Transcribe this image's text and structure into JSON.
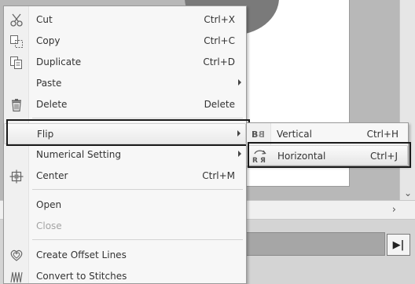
{
  "menu": {
    "items": [
      {
        "id": "cut",
        "label": "Cut",
        "shortcut": "Ctrl+X",
        "icon": "scissors-icon"
      },
      {
        "id": "copy",
        "label": "Copy",
        "shortcut": "Ctrl+C",
        "icon": "copy-icon"
      },
      {
        "id": "duplicate",
        "label": "Duplicate",
        "shortcut": "Ctrl+D",
        "icon": "duplicate-icon"
      },
      {
        "id": "paste",
        "label": "Paste",
        "shortcut": "",
        "submenu": true
      },
      {
        "id": "delete",
        "label": "Delete",
        "shortcut": "Delete",
        "icon": "trash-icon"
      },
      {
        "id": "flip",
        "label": "Flip",
        "shortcut": "",
        "submenu": true,
        "highlighted": true
      },
      {
        "id": "numerical-setting",
        "label": "Numerical Setting",
        "shortcut": "",
        "submenu": true
      },
      {
        "id": "center",
        "label": "Center",
        "shortcut": "Ctrl+M",
        "icon": "center-icon"
      },
      {
        "id": "open",
        "label": "Open",
        "shortcut": ""
      },
      {
        "id": "close",
        "label": "Close",
        "shortcut": "",
        "disabled": true
      },
      {
        "id": "create-offset-lines",
        "label": "Create Offset Lines",
        "shortcut": "",
        "icon": "offset-lines-icon"
      },
      {
        "id": "convert-to-stitches",
        "label": "Convert to Stitches",
        "shortcut": "",
        "icon": "stitches-icon"
      }
    ]
  },
  "submenu": {
    "items": [
      {
        "id": "vertical",
        "label": "Vertical",
        "shortcut": "Ctrl+H",
        "icon": "flip-vertical-icon"
      },
      {
        "id": "horizontal",
        "label": "Horizontal",
        "shortcut": "Ctrl+J",
        "icon": "flip-horizontal-icon",
        "highlighted": true
      }
    ]
  },
  "colors": {
    "menu_bg": "#f7f7f7",
    "highlight_frame": "#1a1a1a",
    "disabled_text": "#a4a4a4"
  }
}
